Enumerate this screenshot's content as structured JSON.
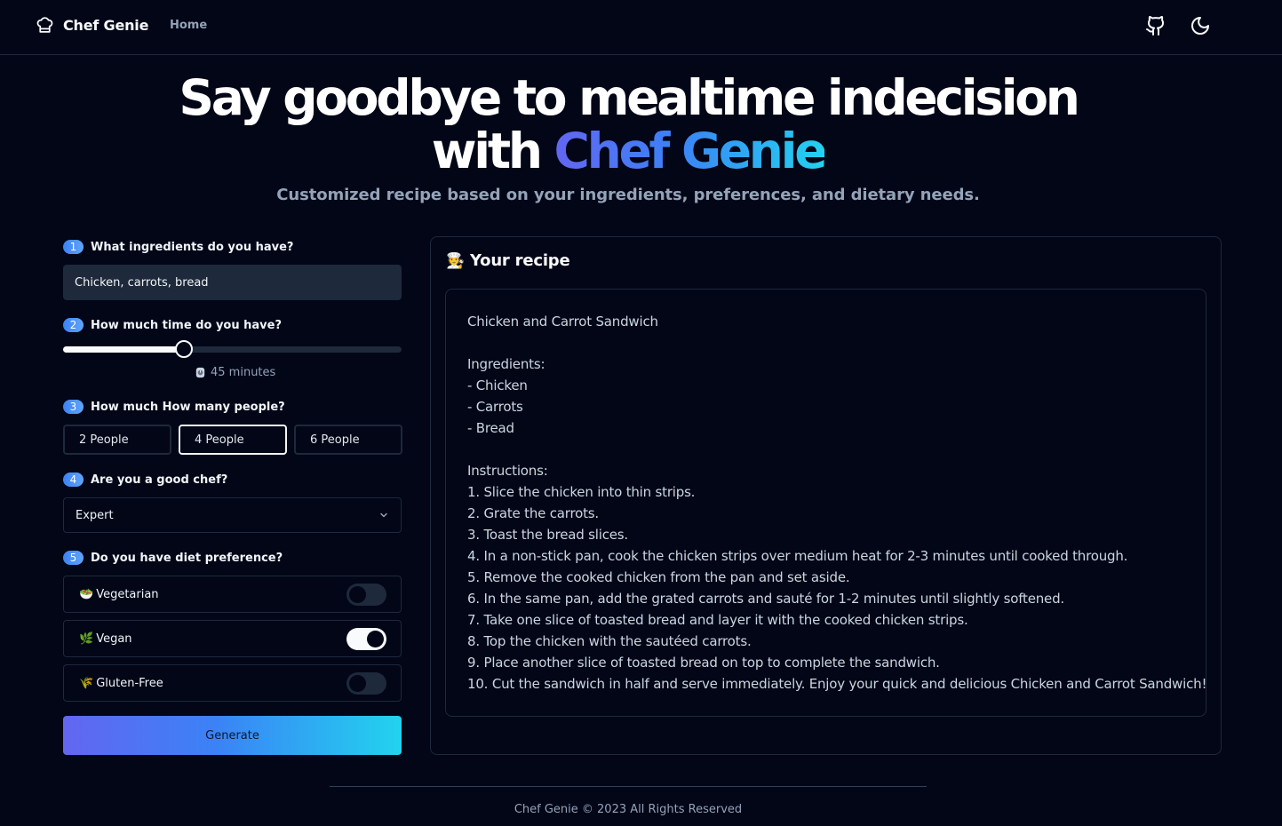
{
  "nav": {
    "brand": "Chef Genie",
    "home": "Home",
    "github_icon": "github-icon",
    "theme_icon": "moon-icon"
  },
  "hero": {
    "title_line1": "Say goodbye to mealtime indecision",
    "title_with": "with ",
    "title_brand": "Chef Genie",
    "subtitle": "Customized recipe based on your ingredients, preferences, and dietary needs."
  },
  "form": {
    "step1": {
      "num": "1",
      "label": "What ingredients do you have?",
      "value": "Chicken, carrots, bread"
    },
    "step2": {
      "num": "2",
      "label": "How much time do you have?",
      "time_label": "45 minutes",
      "time_icon": "timer-icon",
      "slider_fraction": 0.357
    },
    "step3": {
      "num": "3",
      "label": "How much How many people?",
      "options": [
        "2 People",
        "4 People",
        "6 People"
      ],
      "selected": "4 People"
    },
    "step4": {
      "num": "4",
      "label": "Are you a good chef?",
      "selected": "Expert"
    },
    "step5": {
      "num": "5",
      "label": "Do you have diet preference?",
      "options": [
        {
          "emoji": "🥗",
          "label": "Vegetarian",
          "on": false
        },
        {
          "emoji": "🌿",
          "label": "Vegan",
          "on": true
        },
        {
          "emoji": "🌾",
          "label": "Gluten-Free",
          "on": false
        }
      ]
    },
    "generate": "Generate"
  },
  "recipe": {
    "title_emoji": "🧑‍🍳",
    "title": "Your recipe",
    "lines": [
      "Chicken and Carrot Sandwich",
      "",
      "Ingredients:",
      "- Chicken",
      "- Carrots",
      "- Bread",
      "",
      "Instructions:",
      "1. Slice the chicken into thin strips.",
      "2. Grate the carrots.",
      "3. Toast the bread slices.",
      "4. In a non-stick pan, cook the chicken strips over medium heat for 2-3 minutes until cooked through.",
      "5. Remove the cooked chicken from the pan and set aside.",
      "6. In the same pan, add the grated carrots and sauté for 1-2 minutes until slightly softened.",
      "7. Take one slice of toasted bread and layer it with the cooked chicken strips.",
      "8. Top the chicken with the sautéed carrots.",
      "9. Place another slice of toasted bread on top to complete the sandwich.",
      "10. Cut the sandwich in half and serve immediately. Enjoy your quick and delicious Chicken and Carrot Sandwich!"
    ]
  },
  "footer": {
    "text": "Chef Genie  © 2023 All Rights Reserved"
  },
  "colors": {
    "background": "#020617",
    "border": "#1e293b",
    "accent_start": "#6366f1",
    "accent_end": "#22d3ee"
  }
}
